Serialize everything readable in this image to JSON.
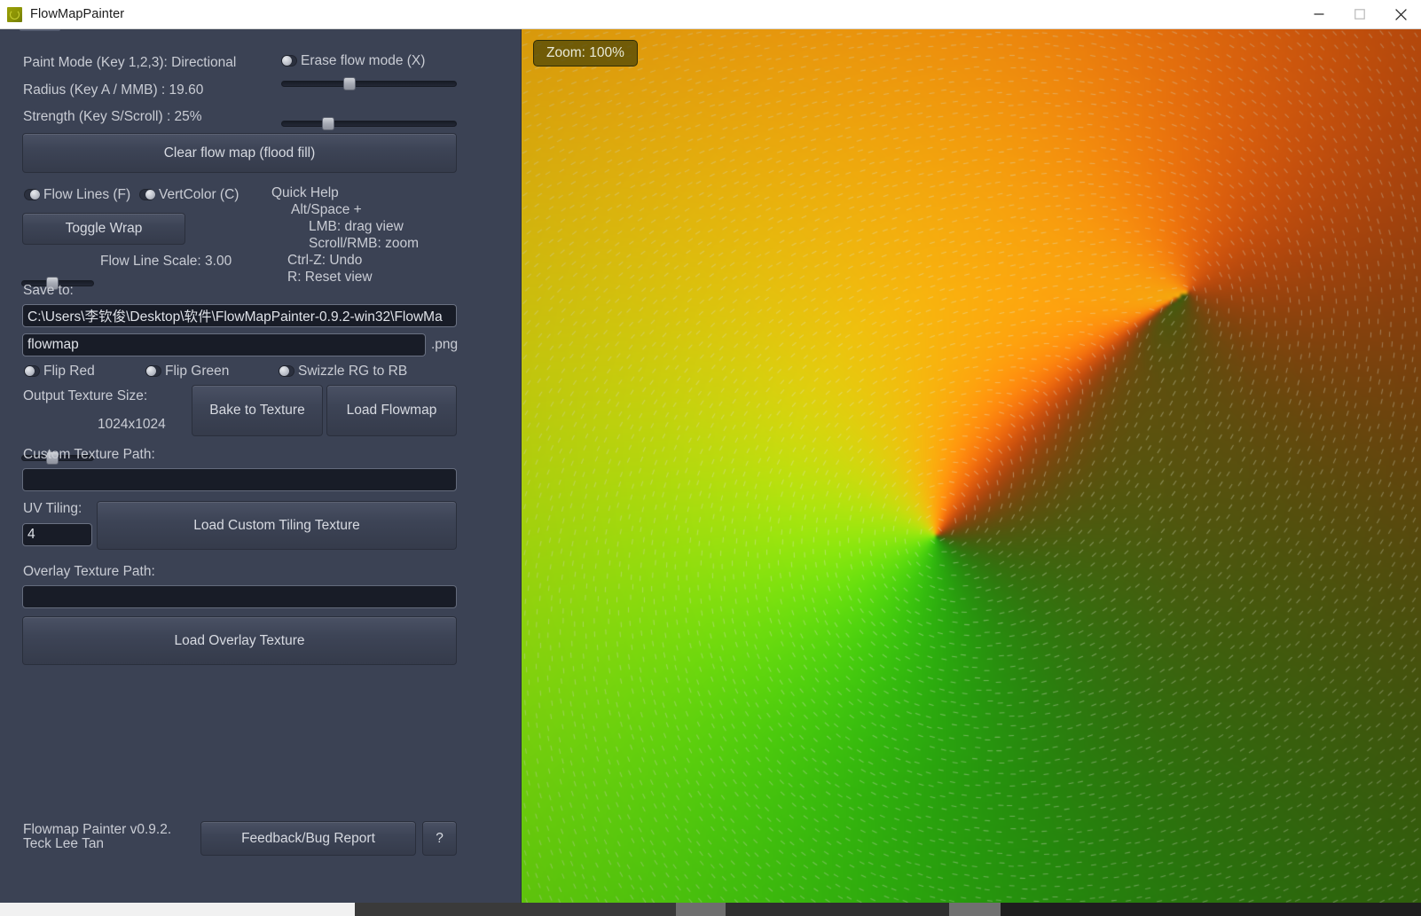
{
  "window": {
    "title": "FlowMapPainter",
    "icon": "flowmap-app-icon",
    "controls": {
      "minimize": "minimize-icon",
      "maximize": "maximize-icon",
      "close": "close-icon"
    }
  },
  "panel": {
    "paint_mode_label": "Paint Mode (Key 1,2,3): Directional",
    "radius_label": "Radius (Key A / MMB) : 19.60",
    "strength_label": "Strength (Key S/Scroll) : 25%",
    "erase_flow_mode_label": "Erase flow mode (X)",
    "erase_flow_mode_checked": false,
    "radius_slider_percent": 39,
    "strength_slider_percent": 27,
    "clear_flow_map_label": "Clear flow map (flood fill)",
    "flow_lines_label": "Flow Lines (F)",
    "flow_lines_checked": true,
    "vert_color_label": "VertColor (C)",
    "vert_color_checked": true,
    "toggle_wrap_label": "Toggle Wrap",
    "flow_line_scale_label": "Flow Line Scale: 3.00",
    "flow_line_scale_percent": 43,
    "quick_help": {
      "title": "Quick Help",
      "lines": [
        "Alt/Space +",
        "LMB: drag view",
        "Scroll/RMB: zoom",
        "Ctrl-Z: Undo",
        "R: Reset view"
      ]
    },
    "save_to_label": "Save to:",
    "save_path_value": "C:\\Users\\李钦俊\\Desktop\\软件\\FlowMapPainter-0.9.2-win32\\FlowMa",
    "file_name_value": "flowmap",
    "file_extension_label": ".png",
    "flip_red_label": "Flip Red",
    "flip_red_checked": false,
    "flip_green_label": "Flip Green",
    "flip_green_checked": false,
    "swizzle_label": "Swizzle RG to RB",
    "swizzle_checked": false,
    "output_texture_size_label": "Output Texture Size:",
    "output_texture_size_value": "1024x1024",
    "output_texture_size_percent": 43,
    "bake_to_texture_label": "Bake to Texture",
    "load_flowmap_label": "Load Flowmap",
    "custom_texture_path_label": "Custom Texture Path:",
    "custom_texture_path_value": "",
    "uv_tiling_label": "UV Tiling:",
    "uv_tiling_value": "4",
    "load_custom_tiling_label": "Load Custom Tiling Texture",
    "overlay_texture_path_label": "Overlay Texture Path:",
    "overlay_texture_path_value": "",
    "load_overlay_texture_label": "Load Overlay Texture",
    "version_line_1": "Flowmap Painter v0.9.2.",
    "version_line_2": "Teck Lee Tan",
    "feedback_label": "Feedback/Bug Report",
    "help_label": "?"
  },
  "viewport": {
    "zoom_label": "Zoom: 100%"
  },
  "colors": {
    "panel_bg": "#3b4254",
    "text": "#c9ccd4",
    "input_bg": "#181c27",
    "button_bg": "#3d4456",
    "zoom_badge_bg": "#464206",
    "canvas_green": "#79b60c",
    "canvas_orange": "#cf7a15",
    "canvas_olive": "#8a8f07"
  }
}
